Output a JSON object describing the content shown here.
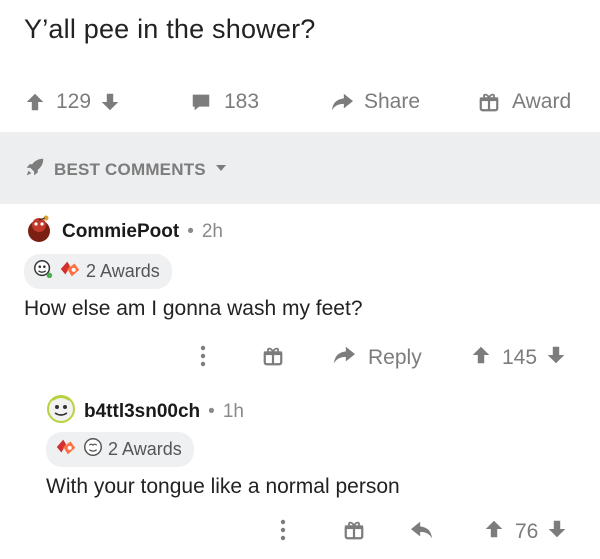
{
  "post": {
    "title": "Y’all pee in the shower?",
    "vote_count": "129",
    "comment_count": "183",
    "share_label": "Share",
    "award_label": "Award"
  },
  "sort_bar": {
    "label": "BEST COMMENTS"
  },
  "comments": [
    {
      "username": "CommiePoot",
      "separator": "•",
      "time": "2h",
      "awards_label": "2 Awards",
      "body": "How else am I gonna wash my feet?",
      "reply_label": "Reply",
      "vote_count": "145"
    },
    {
      "username": "b4ttl3sn00ch",
      "separator": "•",
      "time": "1h",
      "awards_label": "2 Awards",
      "body": "With your tongue like a normal person",
      "vote_count": "76"
    }
  ],
  "colors": {
    "icon_gray": "#7c7c7c",
    "sort_bar_bg": "#eceeef",
    "text": "#1a1a1b"
  },
  "icons": [
    "upvote-icon",
    "downvote-icon",
    "comment-icon",
    "share-icon",
    "award-icon",
    "rocket-icon",
    "chevron-down-icon",
    "more-icon",
    "reply-icon"
  ]
}
